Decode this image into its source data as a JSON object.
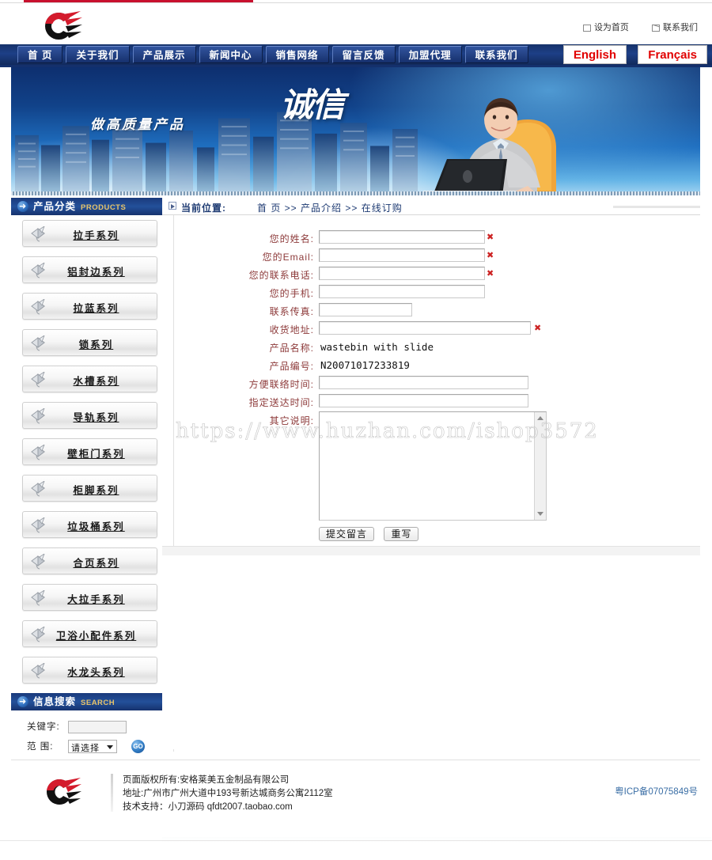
{
  "header": {
    "toplinks": [
      {
        "label": "设为首页",
        "icon": "page-icon"
      },
      {
        "label": "联系我们",
        "icon": "mail-icon"
      }
    ]
  },
  "nav": {
    "items": [
      {
        "label": "首 页"
      },
      {
        "label": "关于我们"
      },
      {
        "label": "产品展示"
      },
      {
        "label": "新闻中心"
      },
      {
        "label": "销售网络"
      },
      {
        "label": "留言反馈"
      },
      {
        "label": "加盟代理"
      },
      {
        "label": "联系我们"
      }
    ],
    "lang_en": "English",
    "lang_fr": "Français"
  },
  "banner": {
    "slogan": "做高质量产品",
    "bigword": "诚信"
  },
  "sidebar": {
    "products_panel": {
      "title": "产品分类",
      "subtitle": "PRODUCTS",
      "items": [
        {
          "label": "拉手系列"
        },
        {
          "label": "铝封边系列"
        },
        {
          "label": "拉蓝系列"
        },
        {
          "label": "锁系列"
        },
        {
          "label": "水槽系列"
        },
        {
          "label": "导轨系列"
        },
        {
          "label": "壁柜门系列"
        },
        {
          "label": "柜脚系列"
        },
        {
          "label": "垃圾桶系列"
        },
        {
          "label": "合页系列"
        },
        {
          "label": "大拉手系列"
        },
        {
          "label": "卫浴小配件系列"
        },
        {
          "label": "水龙头系列"
        }
      ]
    },
    "search_panel": {
      "title": "信息搜索",
      "subtitle": "SEARCH",
      "keyword_label": "关键字:",
      "keyword_value": "",
      "scope_label": "范 围:",
      "scope_selected": "请选择",
      "go_label": "GO"
    }
  },
  "breadcrumb": {
    "label": "当前位置:",
    "items": [
      "首 页",
      "产品介绍",
      "在线订购"
    ],
    "separator": ">>"
  },
  "form": {
    "fields": [
      {
        "label": "您的姓名:",
        "value": "",
        "required": true,
        "width": "w210",
        "type": "input"
      },
      {
        "label": "您的Email:",
        "value": "",
        "required": true,
        "width": "w210",
        "type": "input"
      },
      {
        "label": "您的联系电话:",
        "value": "",
        "required": true,
        "width": "w210",
        "type": "input"
      },
      {
        "label": "您的手机:",
        "value": "",
        "required": false,
        "width": "w210",
        "type": "input"
      },
      {
        "label": "联系传真:",
        "value": "",
        "required": false,
        "width": "w110",
        "type": "input"
      },
      {
        "label": "收货地址:",
        "value": "",
        "required": true,
        "width": "w270",
        "type": "input"
      }
    ],
    "readonly": [
      {
        "label": "产品名称:",
        "value": "wastebin with slide"
      },
      {
        "label": "产品编号:",
        "value": "N20071017233819"
      }
    ],
    "fields2": [
      {
        "label": "方便联络时间:",
        "value": "",
        "required": false,
        "width": "w265",
        "type": "input"
      },
      {
        "label": "指定送达时间:",
        "value": "",
        "required": false,
        "width": "w265",
        "type": "input"
      }
    ],
    "textarea": {
      "label": "其它说明:",
      "value": ""
    },
    "submit_label": "提交留言",
    "reset_label": "重写",
    "required_mark": "✖"
  },
  "watermark": {
    "text": "https://www.huzhan.com/ishop3572"
  },
  "footer": {
    "line1": "页面版权所有:安格莱美五金制品有限公司",
    "line2": "地址:广州市广州大道中193号新达城商务公寓2112室",
    "line3": "技术支持：小刀源码 qfdt2007.taobao.com",
    "icp": "粤ICP备07075849号"
  },
  "colors": {
    "nav_blue": "#16326b",
    "panel_blue": "#1a3a7c",
    "accent_red": "#c8102e",
    "link_red": "#e10000",
    "label_maroon": "#8d3a3a",
    "crumb_blue": "#1d3a72",
    "icp_blue": "#3a6ea5"
  }
}
